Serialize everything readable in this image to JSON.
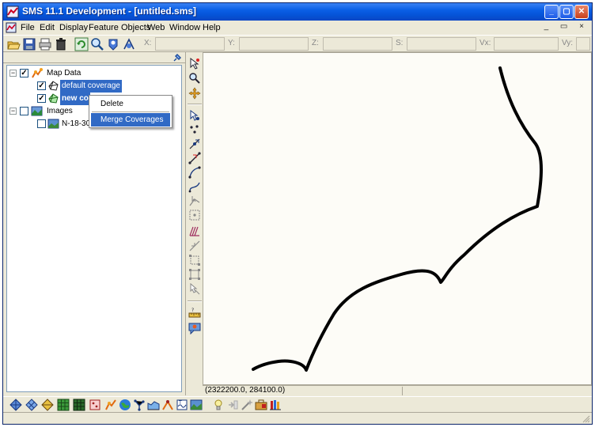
{
  "window": {
    "title": "SMS 11.1 Development - [untitled.sms]"
  },
  "menu": [
    "File",
    "Edit",
    "Display",
    "Feature Objects",
    "Web",
    "Window",
    "Help"
  ],
  "mdi_controls": "_ ▭ ×",
  "coords": {
    "x_label": "X:",
    "y_label": "Y:",
    "z_label": "Z:",
    "s_label": "S:",
    "vx_label": "Vx:",
    "vy_label": "Vy:"
  },
  "tree": {
    "map_data": "Map Data",
    "default_coverage": "default coverage",
    "new_coverage": "new co",
    "images": "Images",
    "image_file": "N-18-30"
  },
  "context_menu": {
    "delete": "Delete",
    "merge": "Merge Coverages"
  },
  "status": {
    "coords": "(2322200.0, 284100.0)"
  },
  "colors": {
    "selection": "#316ac5",
    "titlebar": "#0a5fe6",
    "canvas": "#fdfcf7",
    "arc": "#000000"
  }
}
